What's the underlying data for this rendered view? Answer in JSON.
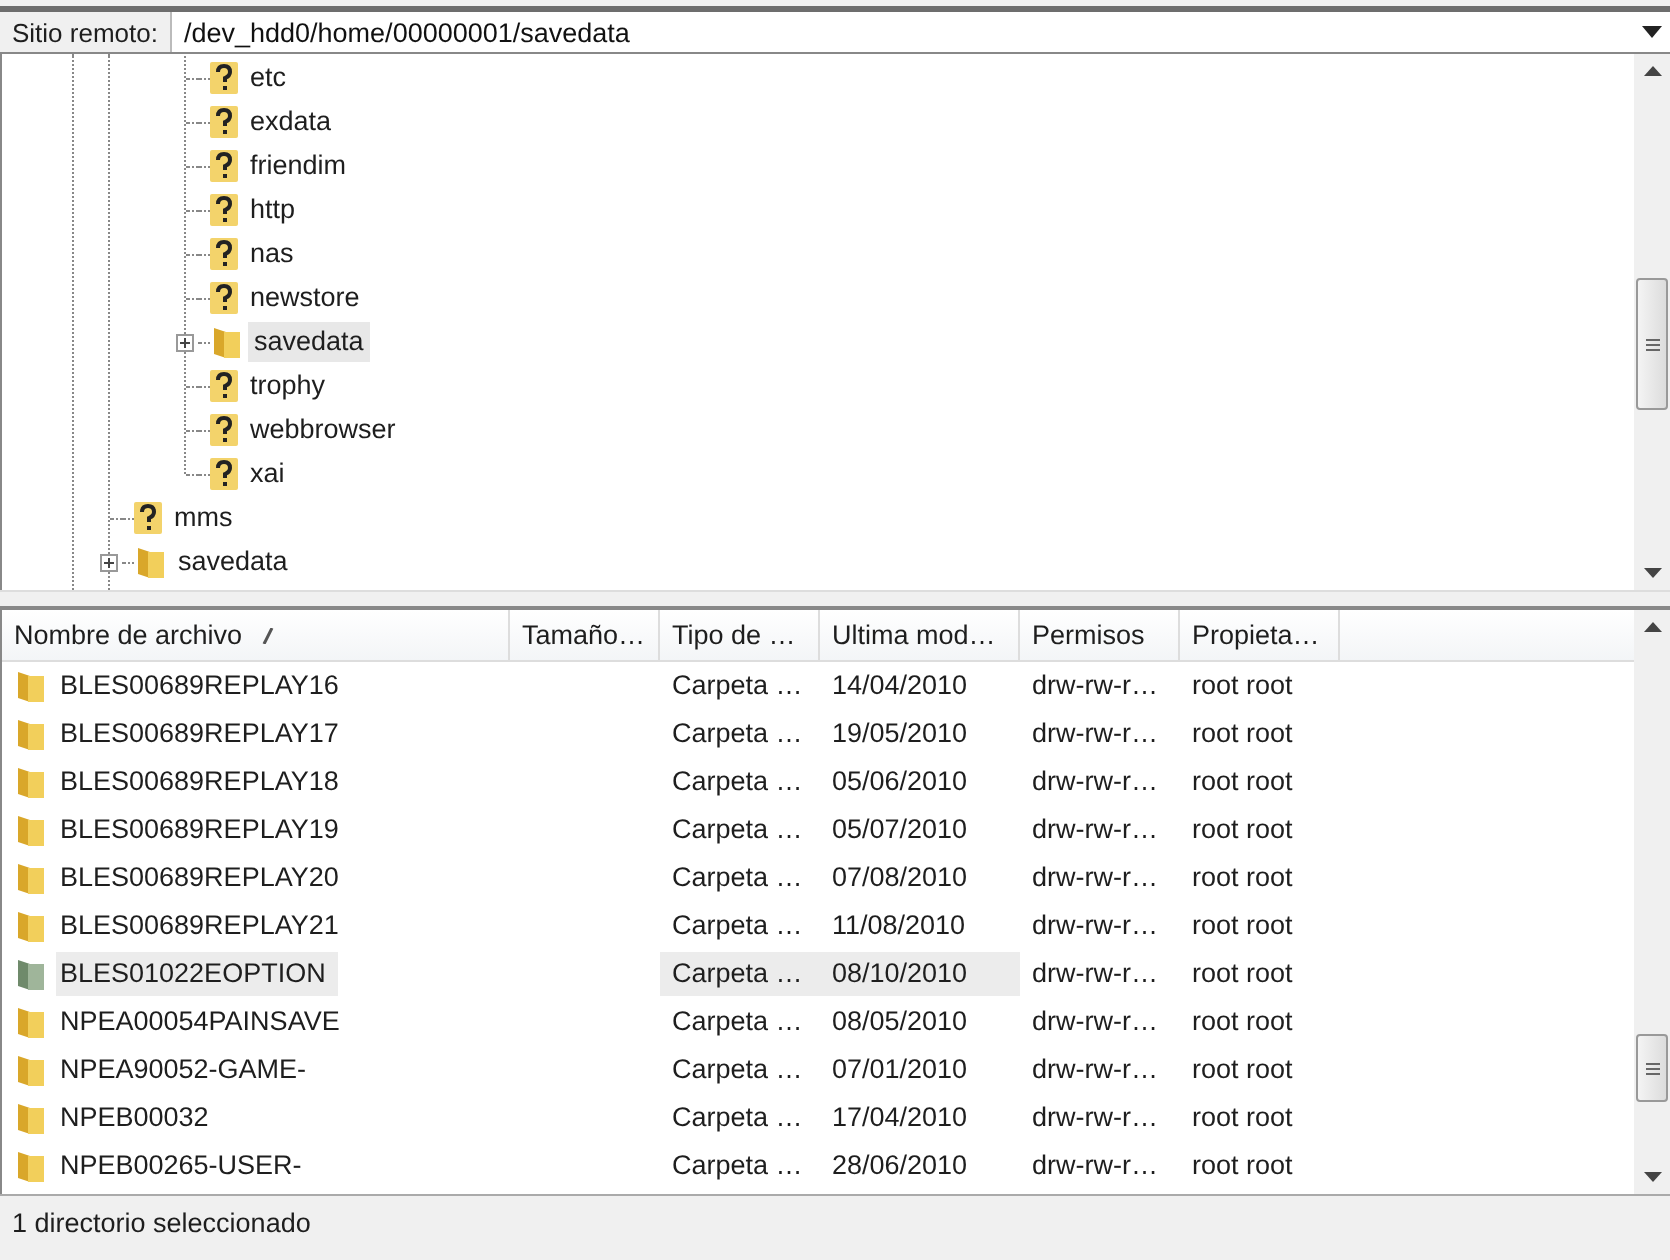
{
  "remote_site": {
    "label": "Sitio remoto:",
    "path": "/dev_hdd0/home/00000001/savedata"
  },
  "tree": {
    "items": [
      {
        "children": [
          {
            "label": "etc",
            "kind": "unknown",
            "expandable": false,
            "selected": false
          },
          {
            "label": "exdata",
            "kind": "unknown",
            "expandable": false,
            "selected": false
          },
          {
            "label": "friendim",
            "kind": "unknown",
            "expandable": false,
            "selected": false
          },
          {
            "label": "http",
            "kind": "unknown",
            "expandable": false,
            "selected": false
          },
          {
            "label": "nas",
            "kind": "unknown",
            "expandable": false,
            "selected": false
          },
          {
            "label": "newstore",
            "kind": "unknown",
            "expandable": false,
            "selected": false
          },
          {
            "label": "savedata",
            "kind": "folder",
            "expandable": true,
            "selected": true
          },
          {
            "label": "trophy",
            "kind": "unknown",
            "expandable": false,
            "selected": false
          },
          {
            "label": "webbrowser",
            "kind": "unknown",
            "expandable": false,
            "selected": false
          },
          {
            "label": "xai",
            "kind": "unknown",
            "expandable": false,
            "selected": false
          }
        ]
      },
      {
        "label": "mms",
        "kind": "unknown",
        "expandable": false,
        "selected": false
      },
      {
        "label": "savedata",
        "kind": "folder",
        "expandable": true,
        "selected": false
      }
    ]
  },
  "files": {
    "columns": [
      {
        "label": "Nombre de archivo",
        "sorted": true
      },
      {
        "label": "Tamaño…",
        "sorted": false
      },
      {
        "label": "Tipo de …",
        "sorted": false
      },
      {
        "label": "Ultima mod…",
        "sorted": false
      },
      {
        "label": "Permisos",
        "sorted": false
      },
      {
        "label": "Propieta…",
        "sorted": false
      }
    ],
    "rows": [
      {
        "name": "BLES00689REPLAY16",
        "type": "Carpeta …",
        "modified": "14/04/2010",
        "permissions": "drw-rw-r…",
        "owner": "root root",
        "selected": false
      },
      {
        "name": "BLES00689REPLAY17",
        "type": "Carpeta …",
        "modified": "19/05/2010",
        "permissions": "drw-rw-r…",
        "owner": "root root",
        "selected": false
      },
      {
        "name": "BLES00689REPLAY18",
        "type": "Carpeta …",
        "modified": "05/06/2010",
        "permissions": "drw-rw-r…",
        "owner": "root root",
        "selected": false
      },
      {
        "name": "BLES00689REPLAY19",
        "type": "Carpeta …",
        "modified": "05/07/2010",
        "permissions": "drw-rw-r…",
        "owner": "root root",
        "selected": false
      },
      {
        "name": "BLES00689REPLAY20",
        "type": "Carpeta …",
        "modified": "07/08/2010",
        "permissions": "drw-rw-r…",
        "owner": "root root",
        "selected": false
      },
      {
        "name": "BLES00689REPLAY21",
        "type": "Carpeta …",
        "modified": "11/08/2010",
        "permissions": "drw-rw-r…",
        "owner": "root root",
        "selected": false
      },
      {
        "name": "BLES01022EOPTION",
        "type": "Carpeta …",
        "modified": "08/10/2010",
        "permissions": "drw-rw-r…",
        "owner": "root root",
        "selected": true
      },
      {
        "name": "NPEA00054PAINSAVE",
        "type": "Carpeta …",
        "modified": "08/05/2010",
        "permissions": "drw-rw-r…",
        "owner": "root root",
        "selected": false
      },
      {
        "name": "NPEA90052-GAME-",
        "type": "Carpeta …",
        "modified": "07/01/2010",
        "permissions": "drw-rw-r…",
        "owner": "root root",
        "selected": false
      },
      {
        "name": "NPEB00032",
        "type": "Carpeta …",
        "modified": "17/04/2010",
        "permissions": "drw-rw-r…",
        "owner": "root root",
        "selected": false
      },
      {
        "name": "NPEB00265-USER-",
        "type": "Carpeta …",
        "modified": "28/06/2010",
        "permissions": "drw-rw-r…",
        "owner": "root root",
        "selected": false
      }
    ]
  },
  "status_bar": "1 directorio seleccionado"
}
